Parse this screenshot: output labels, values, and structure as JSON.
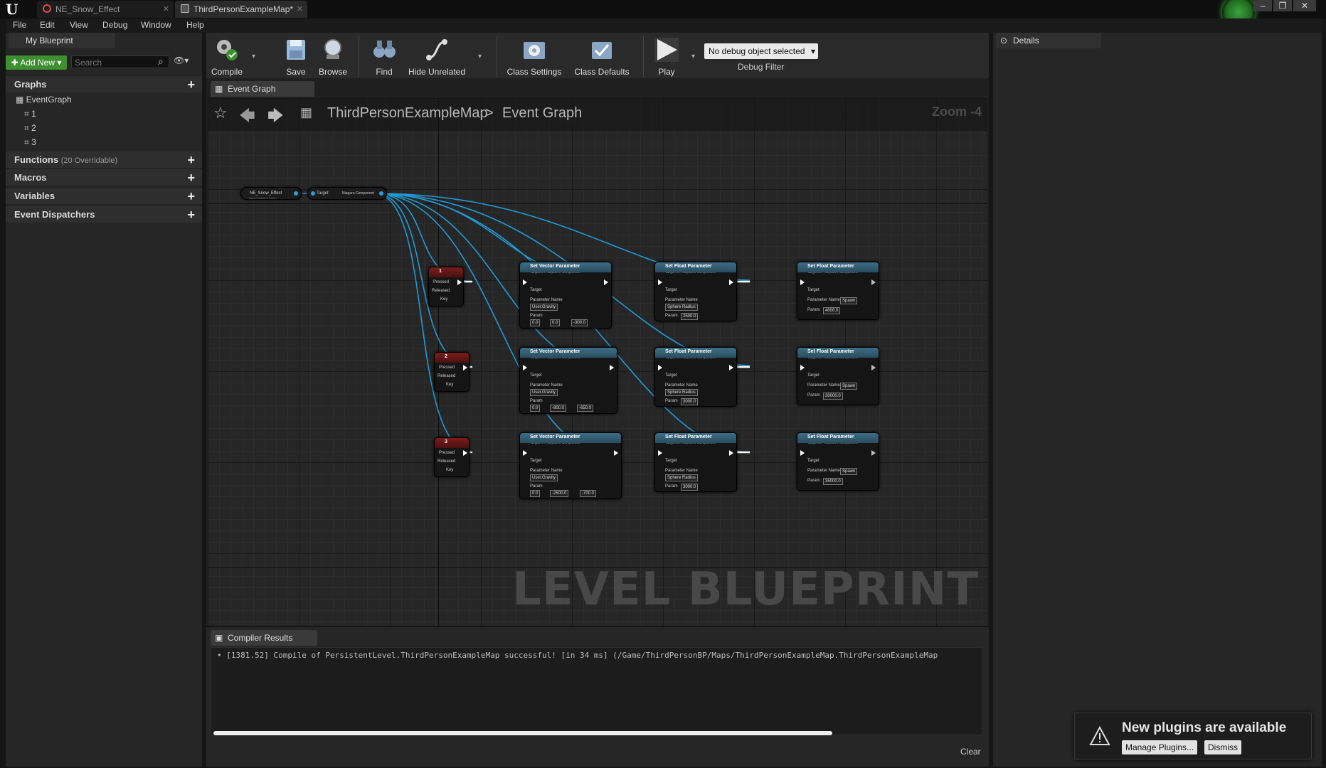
{
  "window": {
    "tabs": [
      {
        "label": "NE_Snow_Effect"
      },
      {
        "label": "ThirdPersonExampleMap*"
      }
    ],
    "controls": {
      "minimize": "–",
      "restore": "❐",
      "close": "✕"
    }
  },
  "menu": {
    "items": [
      "File",
      "Edit",
      "View",
      "Debug",
      "Window",
      "Help"
    ]
  },
  "my_blueprint": {
    "tab_label": "My Blueprint",
    "add_new_label": "Add New",
    "search_placeholder": "Search",
    "sections": {
      "graphs": "Graphs",
      "functions": "Functions",
      "functions_note": "(20 Overridable)",
      "macros": "Macros",
      "variables": "Variables",
      "dispatchers": "Event Dispatchers"
    },
    "tree": {
      "root": "EventGraph",
      "children": [
        "1",
        "2",
        "3"
      ]
    }
  },
  "toolbar": {
    "compile": "Compile",
    "save": "Save",
    "browse": "Browse",
    "find": "Find",
    "hide_unrelated": "Hide Unrelated",
    "class_settings": "Class Settings",
    "class_defaults": "Class Defaults",
    "play": "Play",
    "debug_select": "No debug object selected",
    "debug_filter": "Debug Filter"
  },
  "graph": {
    "tab_label": "Event Graph",
    "breadcrumb": {
      "map": "ThirdPersonExampleMap",
      "separator": ">",
      "graph": "Event Graph"
    },
    "zoom": "Zoom -4",
    "watermark": "LEVEL BLUEPRINT",
    "ref_node": {
      "title": "NE_Snow_Effect",
      "sub": "from Persistent Level"
    },
    "component_node": {
      "target": "Target",
      "output": "Niagara Component"
    },
    "key_nodes": [
      {
        "key": "1",
        "pressed": "Pressed",
        "released": "Released",
        "key_pin": "Key"
      },
      {
        "key": "2",
        "pressed": "Pressed",
        "released": "Released",
        "key_pin": "Key"
      },
      {
        "key": "3",
        "pressed": "Pressed",
        "released": "Released",
        "key_pin": "Key"
      }
    ],
    "vector_nodes": [
      {
        "title": "Set Vector Parameter",
        "sub": "Target is FXSystem Component",
        "target": "Target",
        "pname_label": "Parameter Name",
        "pname": "User.Gravity",
        "param_label": "Param",
        "x": "0.0",
        "y": "0.0",
        "z": "-300.0"
      },
      {
        "title": "Set Vector Parameter",
        "sub": "Target is FXSystem Component",
        "target": "Target",
        "pname_label": "Parameter Name",
        "pname": "User.Gravity",
        "param_label": "Param",
        "x": "0.0",
        "y": "-800.0",
        "z": "-650.0"
      },
      {
        "title": "Set Vector Parameter",
        "sub": "Target is FXSystem Component",
        "target": "Target",
        "pname_label": "Parameter Name",
        "pname": "User.Gravity",
        "param_label": "Param",
        "x": "0.0",
        "y": "-2500.0",
        "z": "-700.0"
      }
    ],
    "float_nodes_a": [
      {
        "title": "Set Float Parameter",
        "sub": "Target is FXSystem Component",
        "target": "Target",
        "pname_label": "Parameter Name",
        "pname": "Sphere Radius",
        "param_label": "Param",
        "value": "2500.0"
      },
      {
        "title": "Set Float Parameter",
        "sub": "Target is FXSystem Component",
        "target": "Target",
        "pname_label": "Parameter Name",
        "pname": "Sphere Radius",
        "param_label": "Param",
        "value": "3000.0"
      },
      {
        "title": "Set Float Parameter",
        "sub": "Target is FXSystem Component",
        "target": "Target",
        "pname_label": "Parameter Name",
        "pname": "Sphere Radius",
        "param_label": "Param",
        "value": "3000.0"
      }
    ],
    "float_nodes_b": [
      {
        "title": "Set Float Parameter",
        "sub": "Target is FXSystem Component",
        "target": "Target",
        "pname_label": "Parameter Name",
        "pname": "Spawn",
        "param_label": "Param",
        "value": "4000.0"
      },
      {
        "title": "Set Float Parameter",
        "sub": "Target is FXSystem Component",
        "target": "Target",
        "pname_label": "Parameter Name",
        "pname": "Spawn",
        "param_label": "Param",
        "value": "30000.0"
      },
      {
        "title": "Set Float Parameter",
        "sub": "Target is FXSystem Component",
        "target": "Target",
        "pname_label": "Parameter Name",
        "pname": "Spawn",
        "param_label": "Param",
        "value": "35000.0"
      }
    ]
  },
  "compiler": {
    "tab_label": "Compiler Results",
    "log": "[1381.52] Compile of PersistentLevel.ThirdPersonExampleMap successful! [in 34 ms] (/Game/ThirdPersonBP/Maps/ThirdPersonExampleMap.ThirdPersonExampleMap",
    "clear": "Clear"
  },
  "details": {
    "tab_label": "Details"
  },
  "notification": {
    "title": "New plugins are available",
    "manage": "Manage Plugins...",
    "dismiss": "Dismiss"
  },
  "colors": {
    "accent_green": "#3d8f2f",
    "wire_blue": "#1f9ad6",
    "node_header": "#3c6d86",
    "key_header": "#7a1c1c"
  }
}
